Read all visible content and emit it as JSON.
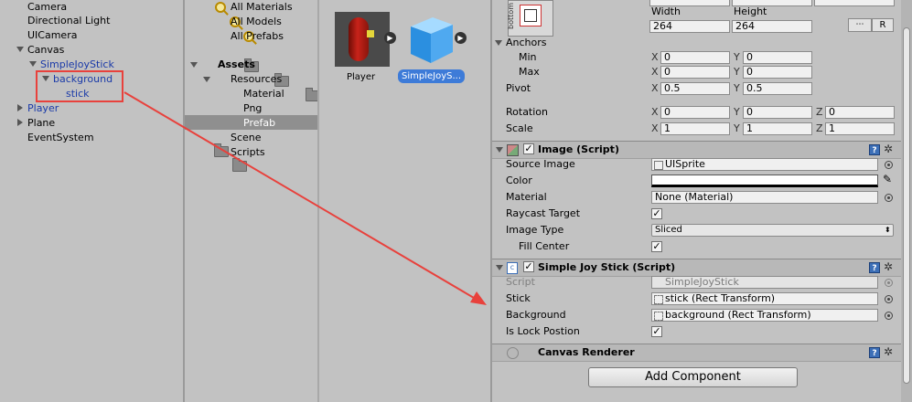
{
  "hierarchy": {
    "items": [
      {
        "label": "Camera"
      },
      {
        "label": "Directional Light"
      },
      {
        "label": "UICamera"
      },
      {
        "label": "Canvas"
      },
      {
        "label": "SimpleJoyStick"
      },
      {
        "label": "background"
      },
      {
        "label": "stick"
      },
      {
        "label": "Player"
      },
      {
        "label": "Plane"
      },
      {
        "label": "EventSystem"
      }
    ]
  },
  "project": {
    "favorites": [
      "All Materials",
      "All Models",
      "All Prefabs"
    ],
    "assets_label": "Assets",
    "folders": [
      "Resources",
      "Material",
      "Png",
      "Prefab",
      "Scene",
      "Scripts"
    ]
  },
  "assets_view": {
    "player_label": "Player",
    "simple_label": "SimpleJoyS..."
  },
  "inspector": {
    "anchor_preset_label": "bottom",
    "width_label": "Width",
    "height_label": "Height",
    "width_value": "264",
    "height_value": "264",
    "r_button": "R",
    "anchors_label": "Anchors",
    "min_label": "Min",
    "max_label": "Max",
    "pivot_label": "Pivot",
    "rotation_label": "Rotation",
    "scale_label": "Scale",
    "x": "X",
    "y": "Y",
    "z": "Z",
    "min_x": "0",
    "min_y": "0",
    "max_x": "0",
    "max_y": "0",
    "pivot_x": "0.5",
    "pivot_y": "0.5",
    "rot_x": "0",
    "rot_y": "0",
    "rot_z": "0",
    "scale_x": "1",
    "scale_y": "1",
    "scale_z": "1",
    "image": {
      "title": "Image (Script)",
      "source_image_label": "Source Image",
      "source_image_value": "UISprite",
      "color_label": "Color",
      "material_label": "Material",
      "material_value": "None (Material)",
      "raycast_label": "Raycast Target",
      "image_type_label": "Image Type",
      "image_type_value": "Sliced",
      "fill_center_label": "Fill Center"
    },
    "joystick": {
      "title": "Simple Joy Stick (Script)",
      "script_label": "Script",
      "script_value": "SimpleJoyStick",
      "stick_label": "Stick",
      "stick_value": "stick (Rect Transform)",
      "background_label": "Background",
      "background_value": "background (Rect Transform)",
      "lock_label": "Is Lock Postion"
    },
    "canvas_renderer_title": "Canvas Renderer",
    "add_component": "Add Component"
  },
  "colors": {
    "annotation_red": "#e8413c",
    "selection_blue": "#3d7bd8"
  }
}
